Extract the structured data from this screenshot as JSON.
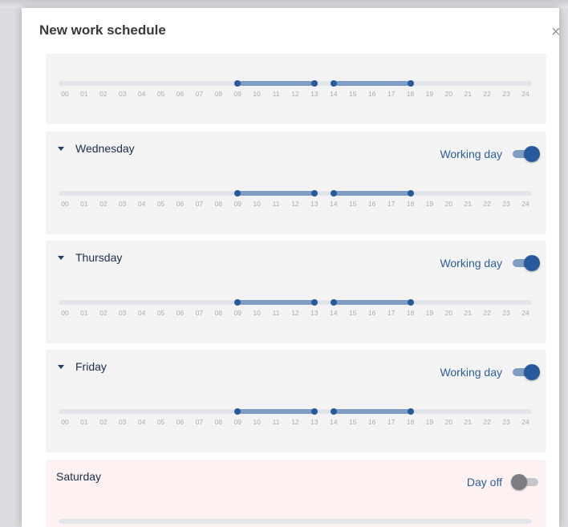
{
  "dialog": {
    "title": "New work schedule",
    "close_glyph": "×"
  },
  "hour_ticks": [
    "00",
    "01",
    "02",
    "03",
    "04",
    "05",
    "06",
    "07",
    "08",
    "09",
    "10",
    "11",
    "12",
    "13",
    "14",
    "15",
    "16",
    "17",
    "18",
    "19",
    "20",
    "21",
    "22",
    "23",
    "24"
  ],
  "days": [
    {
      "name": "",
      "status": "",
      "working": true,
      "show_header": false,
      "intervals": [
        [
          9,
          13
        ],
        [
          14,
          18
        ]
      ]
    },
    {
      "name": "Wednesday",
      "status": "Working day",
      "working": true,
      "show_header": true,
      "intervals": [
        [
          9,
          13
        ],
        [
          14,
          18
        ]
      ]
    },
    {
      "name": "Thursday",
      "status": "Working day",
      "working": true,
      "show_header": true,
      "intervals": [
        [
          9,
          13
        ],
        [
          14,
          18
        ]
      ]
    },
    {
      "name": "Friday",
      "status": "Working day",
      "working": true,
      "show_header": true,
      "intervals": [
        [
          9,
          13
        ],
        [
          14,
          18
        ]
      ]
    },
    {
      "name": "Saturday",
      "status": "Day off",
      "working": false,
      "show_header": true,
      "intervals": []
    }
  ],
  "colors": {
    "accent": "#275a9a",
    "segment": "#7f9dc2",
    "rail": "#e2e6ea",
    "working_card": "#f3f3f4",
    "off_card": "#fdf2f1"
  },
  "icons": {
    "expand": "chevron-down-icon",
    "close": "close-icon"
  }
}
